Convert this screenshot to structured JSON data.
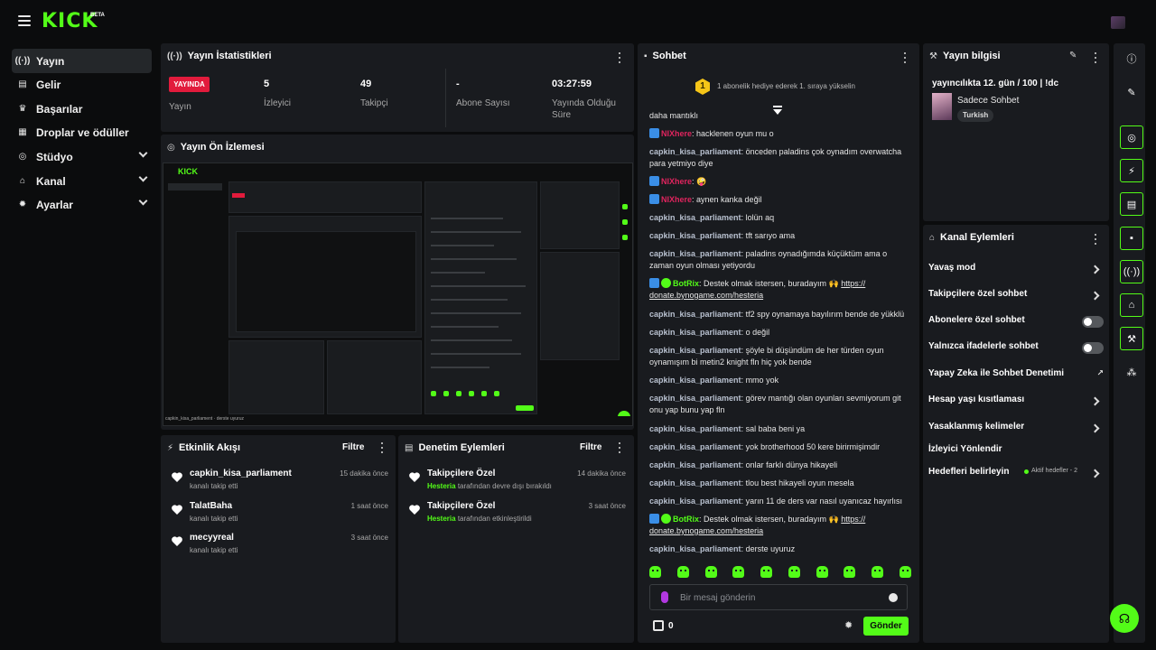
{
  "topbar": {
    "logo": "KICK",
    "beta": "BETA"
  },
  "sidebar": {
    "items": [
      {
        "label": "Yayın",
        "icon": "broadcast-icon"
      },
      {
        "label": "Gelir",
        "icon": "revenue-icon"
      },
      {
        "label": "Başarılar",
        "icon": "trophy-icon"
      },
      {
        "label": "Droplar ve ödüller",
        "icon": "drops-icon"
      },
      {
        "label": "Stüdyo",
        "icon": "studio-icon"
      },
      {
        "label": "Kanal",
        "icon": "channel-icon"
      },
      {
        "label": "Ayarlar",
        "icon": "settings-icon"
      }
    ]
  },
  "stats": {
    "title": "Yayın İstatistikleri",
    "live_badge": "YAYINDA",
    "stream_label": "Yayın",
    "viewers_value": "5",
    "viewers_label": "İzleyici",
    "followers_value": "49",
    "followers_label": "Takipçi",
    "subs_value": "-",
    "subs_label": "Abone Sayısı",
    "uptime_value": "03:27:59",
    "uptime_label": "Yayında Olduğu Süre"
  },
  "preview": {
    "title": "Yayın Ön İzlemesi",
    "mini_logo": "KICK",
    "footer": "capkin_kisa_parliament · derste uyuruz"
  },
  "activity": {
    "title": "Etkinlik Akışı",
    "filter": "Filtre",
    "items": [
      {
        "name": "capkin_kisa_parliament",
        "sub": "kanalı takip etti",
        "time": "15 dakika önce"
      },
      {
        "name": "TalatBaha",
        "sub": "kanalı takip etti",
        "time": "1 saat önce"
      },
      {
        "name": "mecyyreal",
        "sub": "kanalı takip etti",
        "time": "3 saat önce"
      }
    ]
  },
  "moderation": {
    "title": "Denetim Eylemleri",
    "filter": "Filtre",
    "items": [
      {
        "name": "Takipçilere Özel",
        "actor": "Hesteria",
        "sub": "tarafından devre dışı bırakıldı",
        "time": "14 dakika önce"
      },
      {
        "name": "Takipçilere Özel",
        "actor": "Hesteria",
        "sub": "tarafından etkinleştirildi",
        "time": "3 saat önce"
      }
    ]
  },
  "chat": {
    "title": "Sohbet",
    "pinned_rank": "1",
    "pinned_text": "1 abonelik hediye ederek 1. sıraya yükselin",
    "cut_text": "daha mantıklı",
    "messages": [
      {
        "user": "NIXhere",
        "text": ": hacklenen oyun mu o"
      },
      {
        "user": "capkin_kisa_parliament",
        "text": ": önceden paladins çok oynadım overwatcha para yetmiyo diye"
      },
      {
        "user": "NIXhere",
        "text": ": 🤪"
      },
      {
        "user": "NIXhere",
        "text": ": aynen kanka değil"
      },
      {
        "user": "capkin_kisa_parliament",
        "text": ": lolün aq"
      },
      {
        "user": "capkin_kisa_parliament",
        "text": ": tft sarıyo ama"
      },
      {
        "user": "capkin_kisa_parliament",
        "text": ": paladins oynadığımda küçüktüm ama o zaman oyun olması yetiyordu"
      },
      {
        "user": "BotRix",
        "text": ": Destek olmak istersen, buradayım 🙌 ",
        "link": "https:// donate.bynogame.com/hesteria"
      },
      {
        "user": "capkin_kisa_parliament",
        "text": ": tf2 spy oynamaya bayılırım bende de yükklü"
      },
      {
        "user": "capkin_kisa_parliament",
        "text": ": o değil"
      },
      {
        "user": "capkin_kisa_parliament",
        "text": ": şöyle bi düşündüm de her türden oyun oynamışım bi metin2 knight fln hiç yok bende"
      },
      {
        "user": "capkin_kisa_parliament",
        "text": ": mmo yok"
      },
      {
        "user": "capkin_kisa_parliament",
        "text": ": görev mantığı olan oyunları sevmiyorum git onu yap bunu yap fln"
      },
      {
        "user": "capkin_kisa_parliament",
        "text": ": sal baba beni ya"
      },
      {
        "user": "capkin_kisa_parliament",
        "text": ": yok brotherhood 50 kere birirmişimdir"
      },
      {
        "user": "capkin_kisa_parliament",
        "text": ": onlar farklı dünya hikayeli"
      },
      {
        "user": "capkin_kisa_parliament",
        "text": ": tlou best hikayeli oyun mesela"
      },
      {
        "user": "capkin_kisa_parliament",
        "text": ": yarın 11 de ders var nasıl uyanıcaz hayırlısı"
      },
      {
        "user": "BotRix",
        "text": ": Destek olmak istersen, buradayım 🙌 ",
        "link": "https:// donate.bynogame.com/hesteria"
      },
      {
        "user": "capkin_kisa_parliament",
        "text": ": derste uyuruz"
      }
    ],
    "input_placeholder": "Bir mesaj gönderin",
    "points": "0",
    "send_label": "Gönder"
  },
  "stream_info": {
    "title": "Yayın bilgisi",
    "stream_title": "yayıncılıkta 12. gün / 100 | !dc",
    "category": "Sadece Sohbet",
    "tag": "Turkish"
  },
  "channel_actions": {
    "title": "Kanal Eylemleri",
    "slow_mode": "Yavaş mod",
    "followers_only": "Takipçilere özel sohbet",
    "subs_only": "Abonelere özel sohbet",
    "emotes_only": "Yalnızca ifadelerle sohbet",
    "ai_moderation": "Yapay Zeka ile Sohbet Denetimi",
    "account_age": "Hesap yaşı kısıtlaması",
    "banned_words": "Yasaklanmış kelimeler",
    "redirect": "İzleyici Yönlendir",
    "goals": "Hedefleri belirleyin",
    "goals_status": "Aktif hedefler - 2"
  },
  "colors": {
    "accent": "#53fc18",
    "live": "#e21b3c",
    "panel": "#191b1f",
    "bg": "#0b0c0d"
  }
}
